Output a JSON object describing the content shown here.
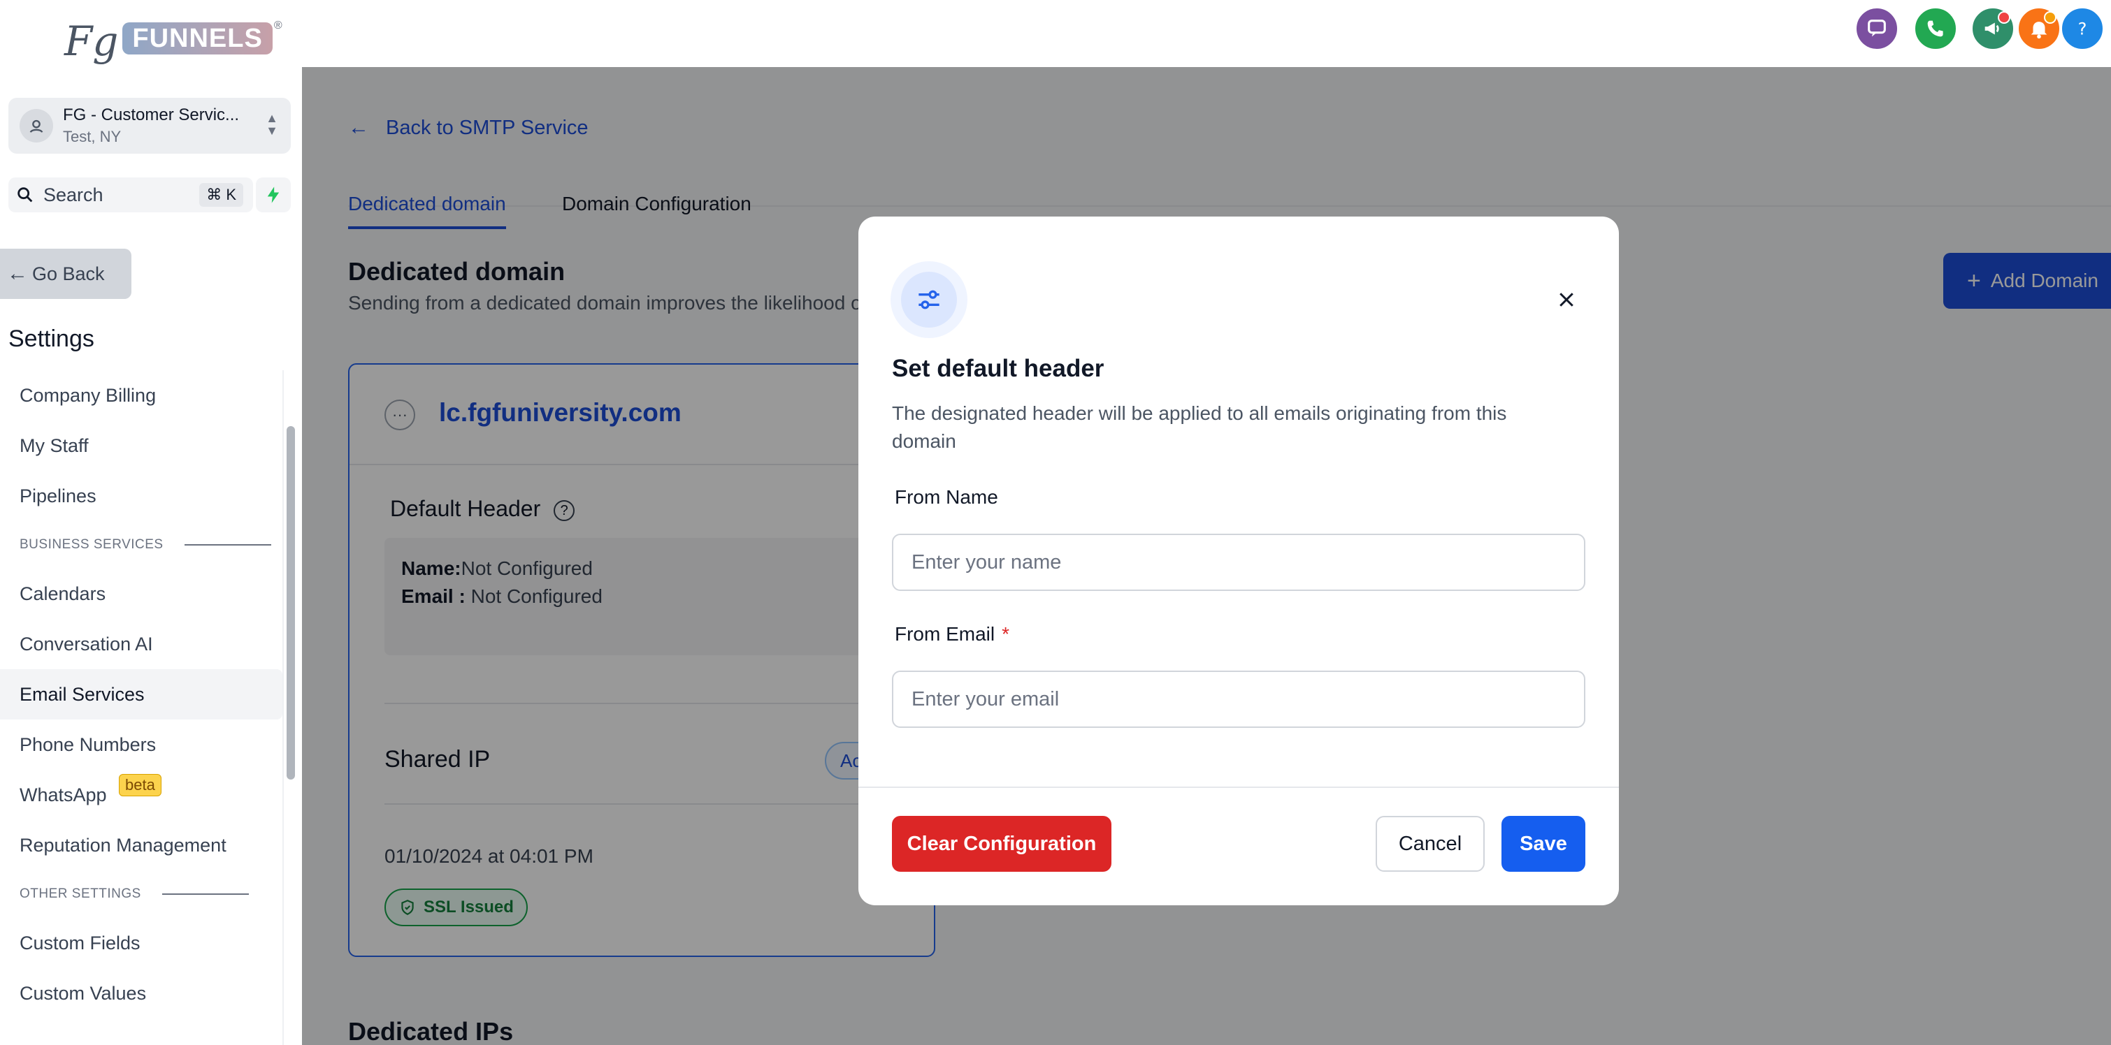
{
  "brand": {
    "logo_fg": "Fg",
    "logo_funnels": "FUNNELS",
    "logo_reg": "®"
  },
  "header": {
    "icons": [
      {
        "name": "chat-icon",
        "color": "#7b4fa0"
      },
      {
        "name": "phone-icon",
        "color": "#22a852"
      },
      {
        "name": "megaphone-icon",
        "color": "#2f8f6a"
      },
      {
        "name": "bell-icon",
        "color": "#f97316"
      },
      {
        "name": "help-icon",
        "color": "#1e88e5"
      }
    ]
  },
  "account": {
    "name": "FG - Customer Servic...",
    "location": "Test, NY"
  },
  "search": {
    "label": "Search",
    "shortcut": "⌘ K"
  },
  "sidebar": {
    "go_back": "Go Back",
    "settings_title": "Settings",
    "items": [
      {
        "label": "Company Billing"
      },
      {
        "label": "My Staff"
      },
      {
        "label": "Pipelines"
      }
    ],
    "section_business": "BUSINESS SERVICES",
    "business_items": [
      {
        "label": "Calendars"
      },
      {
        "label": "Conversation AI"
      },
      {
        "label": "Email Services"
      },
      {
        "label": "Phone Numbers"
      },
      {
        "label": "WhatsApp",
        "badge": "beta"
      },
      {
        "label": "Reputation Management"
      }
    ],
    "section_other": "OTHER SETTINGS",
    "other_items": [
      {
        "label": "Custom Fields"
      },
      {
        "label": "Custom Values"
      }
    ]
  },
  "main": {
    "back_link": "Back to SMTP Service",
    "tabs": [
      {
        "label": "Dedicated domain"
      },
      {
        "label": "Domain Configuration"
      }
    ],
    "section_title": "Dedicated domain",
    "section_desc": "Sending from a dedicated domain improves the likelihood of your emails being delivered to the inbox",
    "add_button": "Add Domain",
    "card": {
      "domain": "lc.fgfuniversity.com",
      "default_header_title": "Default Header",
      "name_label": "Name:",
      "name_value": "Not Configured",
      "email_label": "Email :",
      "email_value": "Not Configured",
      "shared_ip": "Shared IP",
      "status_pill": "Active",
      "date": "01/10/2024 at 04:01 PM",
      "ssl": "SSL Issued"
    },
    "dedicated_ips_title": "Dedicated IPs"
  },
  "modal": {
    "title": "Set default header",
    "description": "The designated header will be applied to all emails originating from this domain",
    "from_name_label": "From Name",
    "from_name_placeholder": "Enter your name",
    "from_email_label": "From Email",
    "required_mark": "*",
    "from_email_placeholder": "Enter your email",
    "clear_button": "Clear Configuration",
    "cancel_button": "Cancel",
    "save_button": "Save"
  },
  "colors": {
    "primary": "#155eef",
    "danger": "#dc2626",
    "success": "#16a34a"
  }
}
